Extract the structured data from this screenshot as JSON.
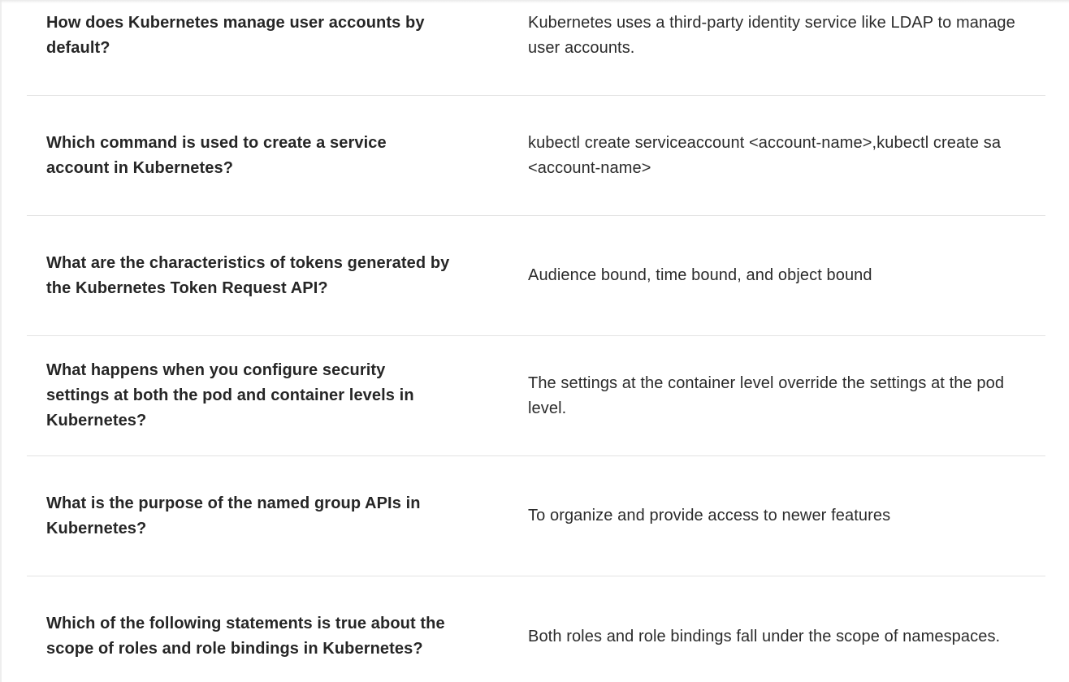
{
  "qa_rows": [
    {
      "question": "How does Kubernetes manage user accounts by default?",
      "answer": "Kubernetes uses a third-party identity service like LDAP to manage user accounts."
    },
    {
      "question": "Which command is used to create a service account in Kubernetes?",
      "answer": "kubectl create serviceaccount <account-name>,kubectl create sa <account-name>"
    },
    {
      "question": "What are the characteristics of tokens generated by the Kubernetes Token Request API?",
      "answer": "Audience bound, time bound, and object bound"
    },
    {
      "question": "What happens when you configure security settings at both the pod and container levels in Kubernetes?",
      "answer": "The settings at the container level override the settings at the pod level."
    },
    {
      "question": "What is the purpose of the named group APIs in Kubernetes?",
      "answer": "To organize and provide access to newer features"
    },
    {
      "question": "Which of the following statements is true about the scope of roles and role bindings in Kubernetes?",
      "answer": "Both roles and role bindings fall under the scope of namespaces."
    }
  ]
}
